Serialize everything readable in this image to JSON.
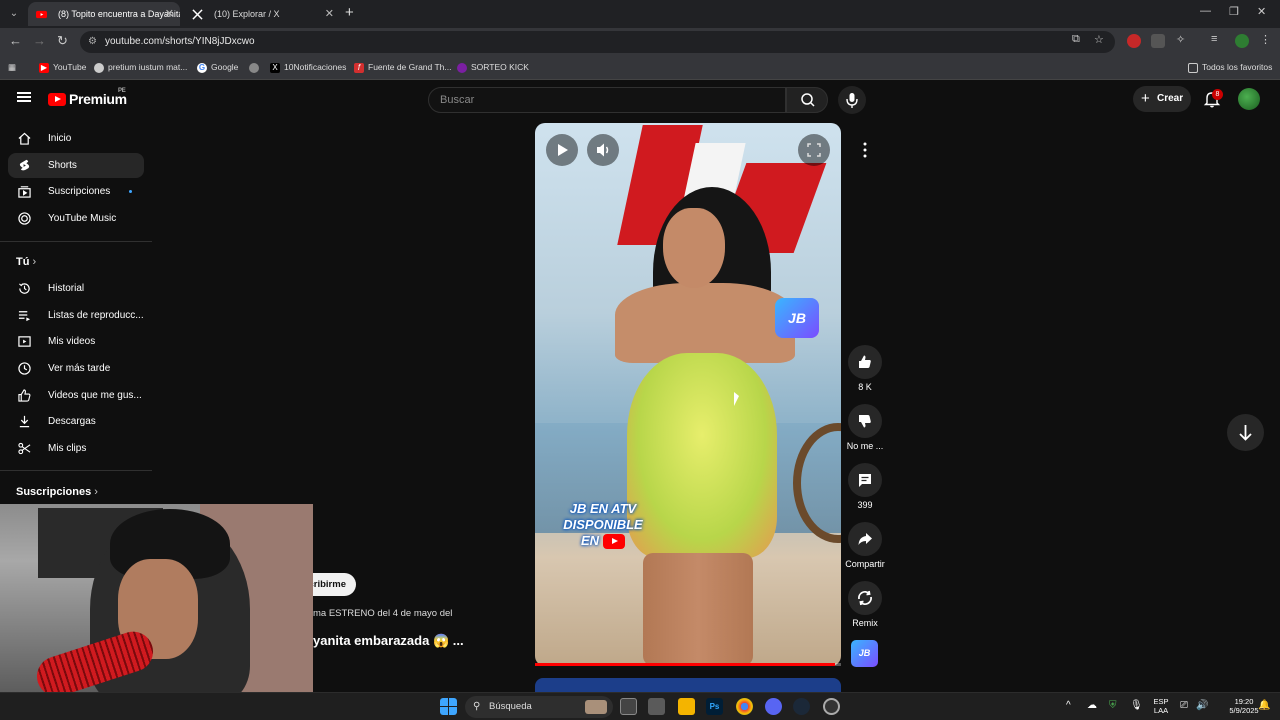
{
  "browser": {
    "tabs": [
      {
        "title": "(8) Topito encuentra a Dayanita",
        "active": true
      },
      {
        "title": "(10) Explorar / X",
        "active": false
      }
    ],
    "url": "youtube.com/shorts/YIN8jJDxcwo",
    "bookmarks": [
      {
        "label": "YouTube",
        "icon": "youtube-icon",
        "color": "#ff0000"
      },
      {
        "label": "pretium iustum mat...",
        "icon": "globe-icon",
        "color": "#cccccc"
      },
      {
        "label": "Google",
        "icon": "google-icon",
        "color": "#4285f4"
      },
      {
        "label": "",
        "icon": "globe-icon",
        "color": "#888888"
      },
      {
        "label": "10Notificaciones",
        "icon": "x-icon",
        "color": "#000000"
      },
      {
        "label": "Fuente de Grand Th...",
        "icon": "font-icon",
        "color": "#d32f2f"
      },
      {
        "label": "SORTEO KICK",
        "icon": "kick-icon",
        "color": "#7b1fa2"
      }
    ],
    "all_bookmarks_label": "Todos los favoritos"
  },
  "header": {
    "logo_text": "Premium",
    "region": "PE",
    "search_placeholder": "Buscar",
    "create_label": "Crear",
    "notification_count": "8"
  },
  "sidebar": {
    "main": [
      {
        "label": "Inicio",
        "icon": "home-icon",
        "active": false
      },
      {
        "label": "Shorts",
        "icon": "shorts-icon",
        "active": true
      },
      {
        "label": "Suscripciones",
        "icon": "subscriptions-icon",
        "active": false
      },
      {
        "label": "YouTube Music",
        "icon": "music-icon",
        "active": false
      }
    ],
    "you_heading": "Tú",
    "you": [
      {
        "label": "Historial",
        "icon": "history-icon"
      },
      {
        "label": "Listas de reproducc...",
        "icon": "playlist-icon"
      },
      {
        "label": "Mis videos",
        "icon": "video-icon"
      },
      {
        "label": "Ver más tarde",
        "icon": "clock-icon"
      },
      {
        "label": "Videos que me gus...",
        "icon": "like-icon"
      },
      {
        "label": "Descargas",
        "icon": "download-icon"
      },
      {
        "label": "Mis clips",
        "icon": "scissors-icon"
      }
    ],
    "subs_heading": "Suscripciones"
  },
  "short": {
    "overlay_text_lines": [
      "JB EN ATV",
      "DISPONIBLE",
      "EN"
    ],
    "badge_text": "JB",
    "subscribe_label": "cribirme",
    "description": "ma ESTRENO del 4 de mayo del",
    "title": "yanita embarazada 😱 ...",
    "progress_fraction": 0.98,
    "actions": {
      "likes": "8 K",
      "dislike_label": "No me ...",
      "comments": "399",
      "share_label": "Compartir",
      "remix_label": "Remix"
    },
    "channel_thumb_text": "JB"
  },
  "taskbar": {
    "search_label": "Búsqueda",
    "lang_top": "ESP",
    "lang_bottom": "LAA",
    "time": "19:20",
    "date": "5/9/2025",
    "app_label_ps": "Ps"
  }
}
